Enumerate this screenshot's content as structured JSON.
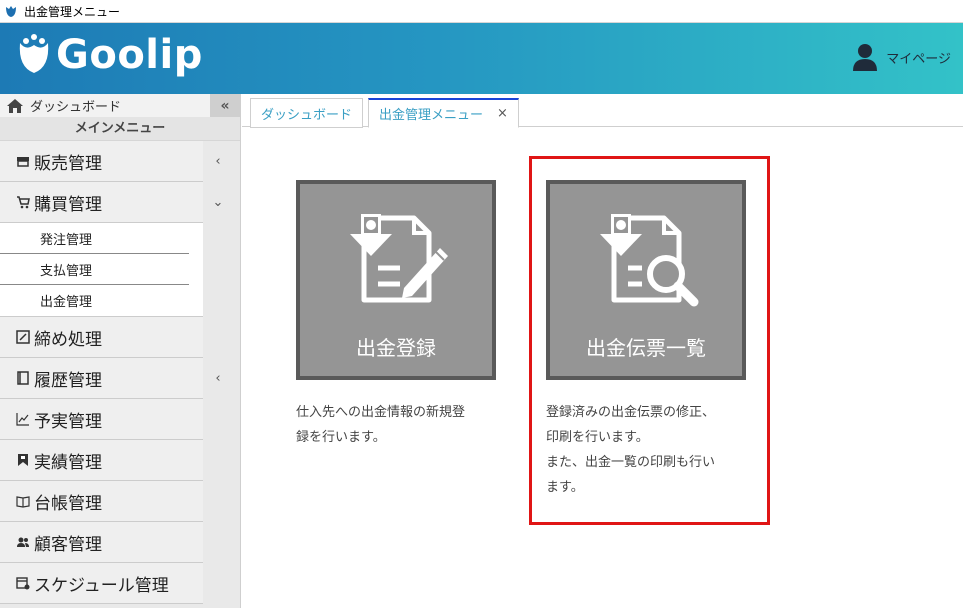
{
  "window": {
    "title": "出金管理メニュー"
  },
  "header": {
    "logo_text": "Goolip",
    "mypage_label": "マイページ"
  },
  "sidebar": {
    "dashboard_label": "ダッシュボード",
    "collapse_symbol": "«",
    "main_menu_title": "メインメニュー",
    "items": [
      {
        "label": "販売管理",
        "icon": "store-icon",
        "caret": "‹"
      },
      {
        "label": "購買管理",
        "icon": "cart-icon",
        "caret": "⌄"
      },
      {
        "label": "締め処理",
        "icon": "check-square-icon",
        "caret": ""
      },
      {
        "label": "履歴管理",
        "icon": "book-icon",
        "caret": "‹"
      },
      {
        "label": "予実管理",
        "icon": "chart-icon",
        "caret": ""
      },
      {
        "label": "実績管理",
        "icon": "bookmark-icon",
        "caret": ""
      },
      {
        "label": "台帳管理",
        "icon": "open-book-icon",
        "caret": ""
      },
      {
        "label": "顧客管理",
        "icon": "users-icon",
        "caret": ""
      },
      {
        "label": "スケジュール管理",
        "icon": "calendar-icon",
        "caret": ""
      }
    ],
    "submenu": [
      {
        "label": "発注管理"
      },
      {
        "label": "支払管理"
      },
      {
        "label": "出金管理"
      }
    ]
  },
  "tabs": [
    {
      "label": "ダッシュボード",
      "active": false
    },
    {
      "label": "出金管理メニュー",
      "active": true,
      "close": "×"
    }
  ],
  "main": {
    "tiles": [
      {
        "label": "出金登録",
        "icon": "payment-edit-icon",
        "description_lines": [
          "仕入先への出金情報の新規登",
          "録を行います。"
        ]
      },
      {
        "label": "出金伝票一覧",
        "icon": "payment-search-icon",
        "description_lines": [
          "登録済みの出金伝票の修正、",
          "印刷を行います。",
          "また、出金一覧の印刷も行い",
          "ます。"
        ]
      }
    ]
  },
  "colors": {
    "header_start": "#1d7ab5",
    "header_end": "#33c2c8",
    "tile_bg": "#959595",
    "tile_border": "#5a5a5a",
    "highlight": "#e01515",
    "active_tab_border": "#1b45d6"
  }
}
